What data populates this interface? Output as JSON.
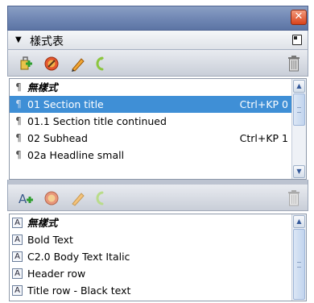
{
  "window": {
    "close_label": "✕"
  },
  "panel": {
    "title": "樣式表",
    "collapse_arrow": "▼"
  },
  "paragraph_styles": {
    "items": [
      {
        "name": "無樣式",
        "shortcut": "",
        "italic": true,
        "selected": false
      },
      {
        "name": "01 Section title",
        "shortcut": "Ctrl+KP 0",
        "italic": false,
        "selected": true
      },
      {
        "name": "01.1 Section title continued",
        "shortcut": "",
        "italic": false,
        "selected": false
      },
      {
        "name": "02 Subhead",
        "shortcut": "Ctrl+KP 1",
        "italic": false,
        "selected": false
      },
      {
        "name": "02a Headline small",
        "shortcut": "",
        "italic": false,
        "selected": false
      }
    ],
    "paragraph_glyph": "¶"
  },
  "character_styles": {
    "items": [
      {
        "name": "無樣式",
        "italic": true
      },
      {
        "name": "Bold Text",
        "italic": false
      },
      {
        "name": "C2.0 Body Text Italic",
        "italic": false
      },
      {
        "name": "Header row",
        "italic": false
      },
      {
        "name": "Title row - Black text",
        "italic": false
      }
    ],
    "char_glyph": "A"
  },
  "scroll": {
    "up": "▲",
    "down": "▼"
  },
  "colors": {
    "titlebar": "#6f86b3",
    "selection": "#3f8fd6",
    "close": "#d9431c"
  },
  "icons": {
    "toolbar1": [
      "new-paragraph-style-icon",
      "edit-style-icon",
      "pencil-icon",
      "update-style-icon",
      "trash-icon"
    ],
    "toolbar2": [
      "new-character-style-icon",
      "edit-style-icon",
      "pencil-icon",
      "update-style-icon",
      "trash-icon"
    ]
  }
}
